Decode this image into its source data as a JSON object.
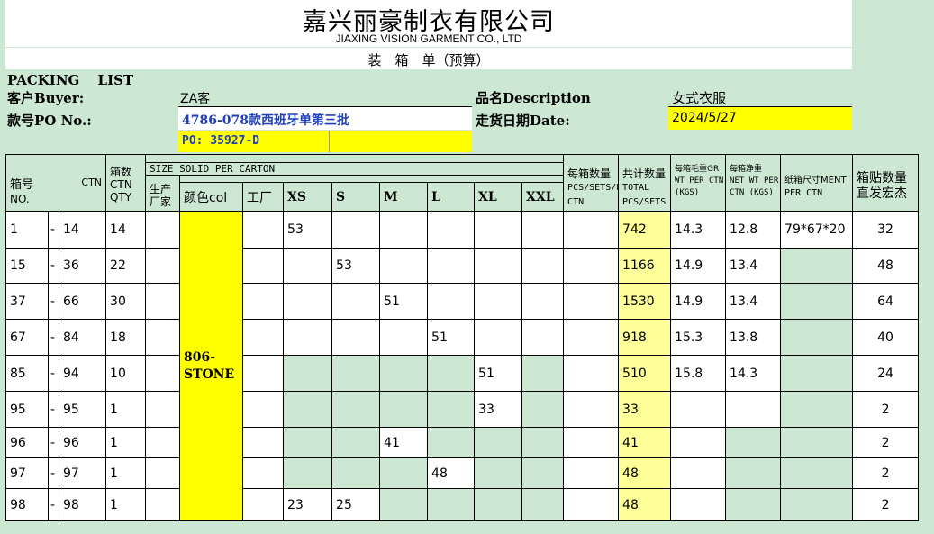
{
  "header": {
    "company_cn": "嘉兴丽豪制衣有限公司",
    "company_en": "JIAXING VISION GARMENT CO., LTD",
    "doc_title": "装　箱　单（预算）",
    "packing_list": "PACKING　 LIST"
  },
  "info": {
    "buyer_label": "客户Buyer:",
    "buyer_value": "ZA客",
    "desc_label": "品名Description",
    "desc_value": "女式衣服",
    "po_label": "款号PO No.:",
    "po_value": "4786-078款西班牙单第三批",
    "date_label": "走货日期Date:",
    "date_value": "2024/5/27",
    "po_number": "PO: 35927-D"
  },
  "columns": {
    "box_no": "箱号",
    "box_no_en": "NO.",
    "ctn": "CTN",
    "box_count": "箱数",
    "box_count_ctn": "CTN",
    "box_count_qty": "QTY",
    "size_solid": "SIZE SOLID PER CARTON",
    "producer": "生产厂家",
    "color": "颜色col",
    "factory": "工厂",
    "sizes": [
      "XS",
      "S",
      "M",
      "L",
      "XL",
      "XXL"
    ],
    "per_box": "每箱数量",
    "per_box_en": "PCS/SETS/PER CTN",
    "total": "共计数量",
    "total_en": "TOTAL PCS/SETS",
    "gross": "每箱毛重GR",
    "gross_en": "WT PER CTN (KGS)",
    "net": "每箱净重",
    "net_en": "NET WT PER CTN (KGS)",
    "carton_size": "纸箱尺寸MENT",
    "carton_size_en": "PER CTN",
    "label_count": "箱贴数量",
    "label_count2": "直发宏杰"
  },
  "color_value": "806-STONE",
  "rows": [
    {
      "from": "1",
      "to": "14",
      "qty": "14",
      "size_col": 0,
      "size_val": "53",
      "total": "742",
      "gross": "14.3",
      "net": "12.8",
      "dim": "79*67*20",
      "labels": "32"
    },
    {
      "from": "15",
      "to": "36",
      "qty": "22",
      "size_col": 1,
      "size_val": "53",
      "total": "1166",
      "gross": "14.9",
      "net": "13.4",
      "dim": "",
      "labels": "48"
    },
    {
      "from": "37",
      "to": "66",
      "qty": "30",
      "size_col": 2,
      "size_val": "51",
      "total": "1530",
      "gross": "14.9",
      "net": "13.4",
      "dim": "",
      "labels": "64"
    },
    {
      "from": "67",
      "to": "84",
      "qty": "18",
      "size_col": 3,
      "size_val": "51",
      "total": "918",
      "gross": "15.3",
      "net": "13.8",
      "dim": "",
      "labels": "40"
    },
    {
      "from": "85",
      "to": "94",
      "qty": "10",
      "size_col": 4,
      "size_val": "51",
      "total": "510",
      "gross": "15.8",
      "net": "14.3",
      "dim": "",
      "labels": "24"
    },
    {
      "from": "95",
      "to": "95",
      "qty": "1",
      "size_col": 4,
      "size_val": "33",
      "total": "33",
      "gross": "",
      "net": "",
      "dim": "",
      "labels": "2"
    },
    {
      "from": "96",
      "to": "96",
      "qty": "1",
      "size_col": 2,
      "size_val": "41",
      "total": "41",
      "gross": "",
      "net": "",
      "dim": "",
      "labels": "2"
    },
    {
      "from": "97",
      "to": "97",
      "qty": "1",
      "size_col": 3,
      "size_val": "48",
      "total": "48",
      "gross": "",
      "net": "",
      "dim": "",
      "labels": "2"
    },
    {
      "from": "98",
      "to": "98",
      "qty": "1",
      "size_col": 0,
      "size_val": "23",
      "size_col2": 1,
      "size_val2": "25",
      "total": "48",
      "gross": "",
      "net": "",
      "dim": "",
      "labels": "2"
    }
  ],
  "colors": {
    "sheet_green": "#cde8d2",
    "highlight_yellow": "#ffff00",
    "light_yellow": "#ffff99",
    "po_blue": "#1f3fbf"
  }
}
